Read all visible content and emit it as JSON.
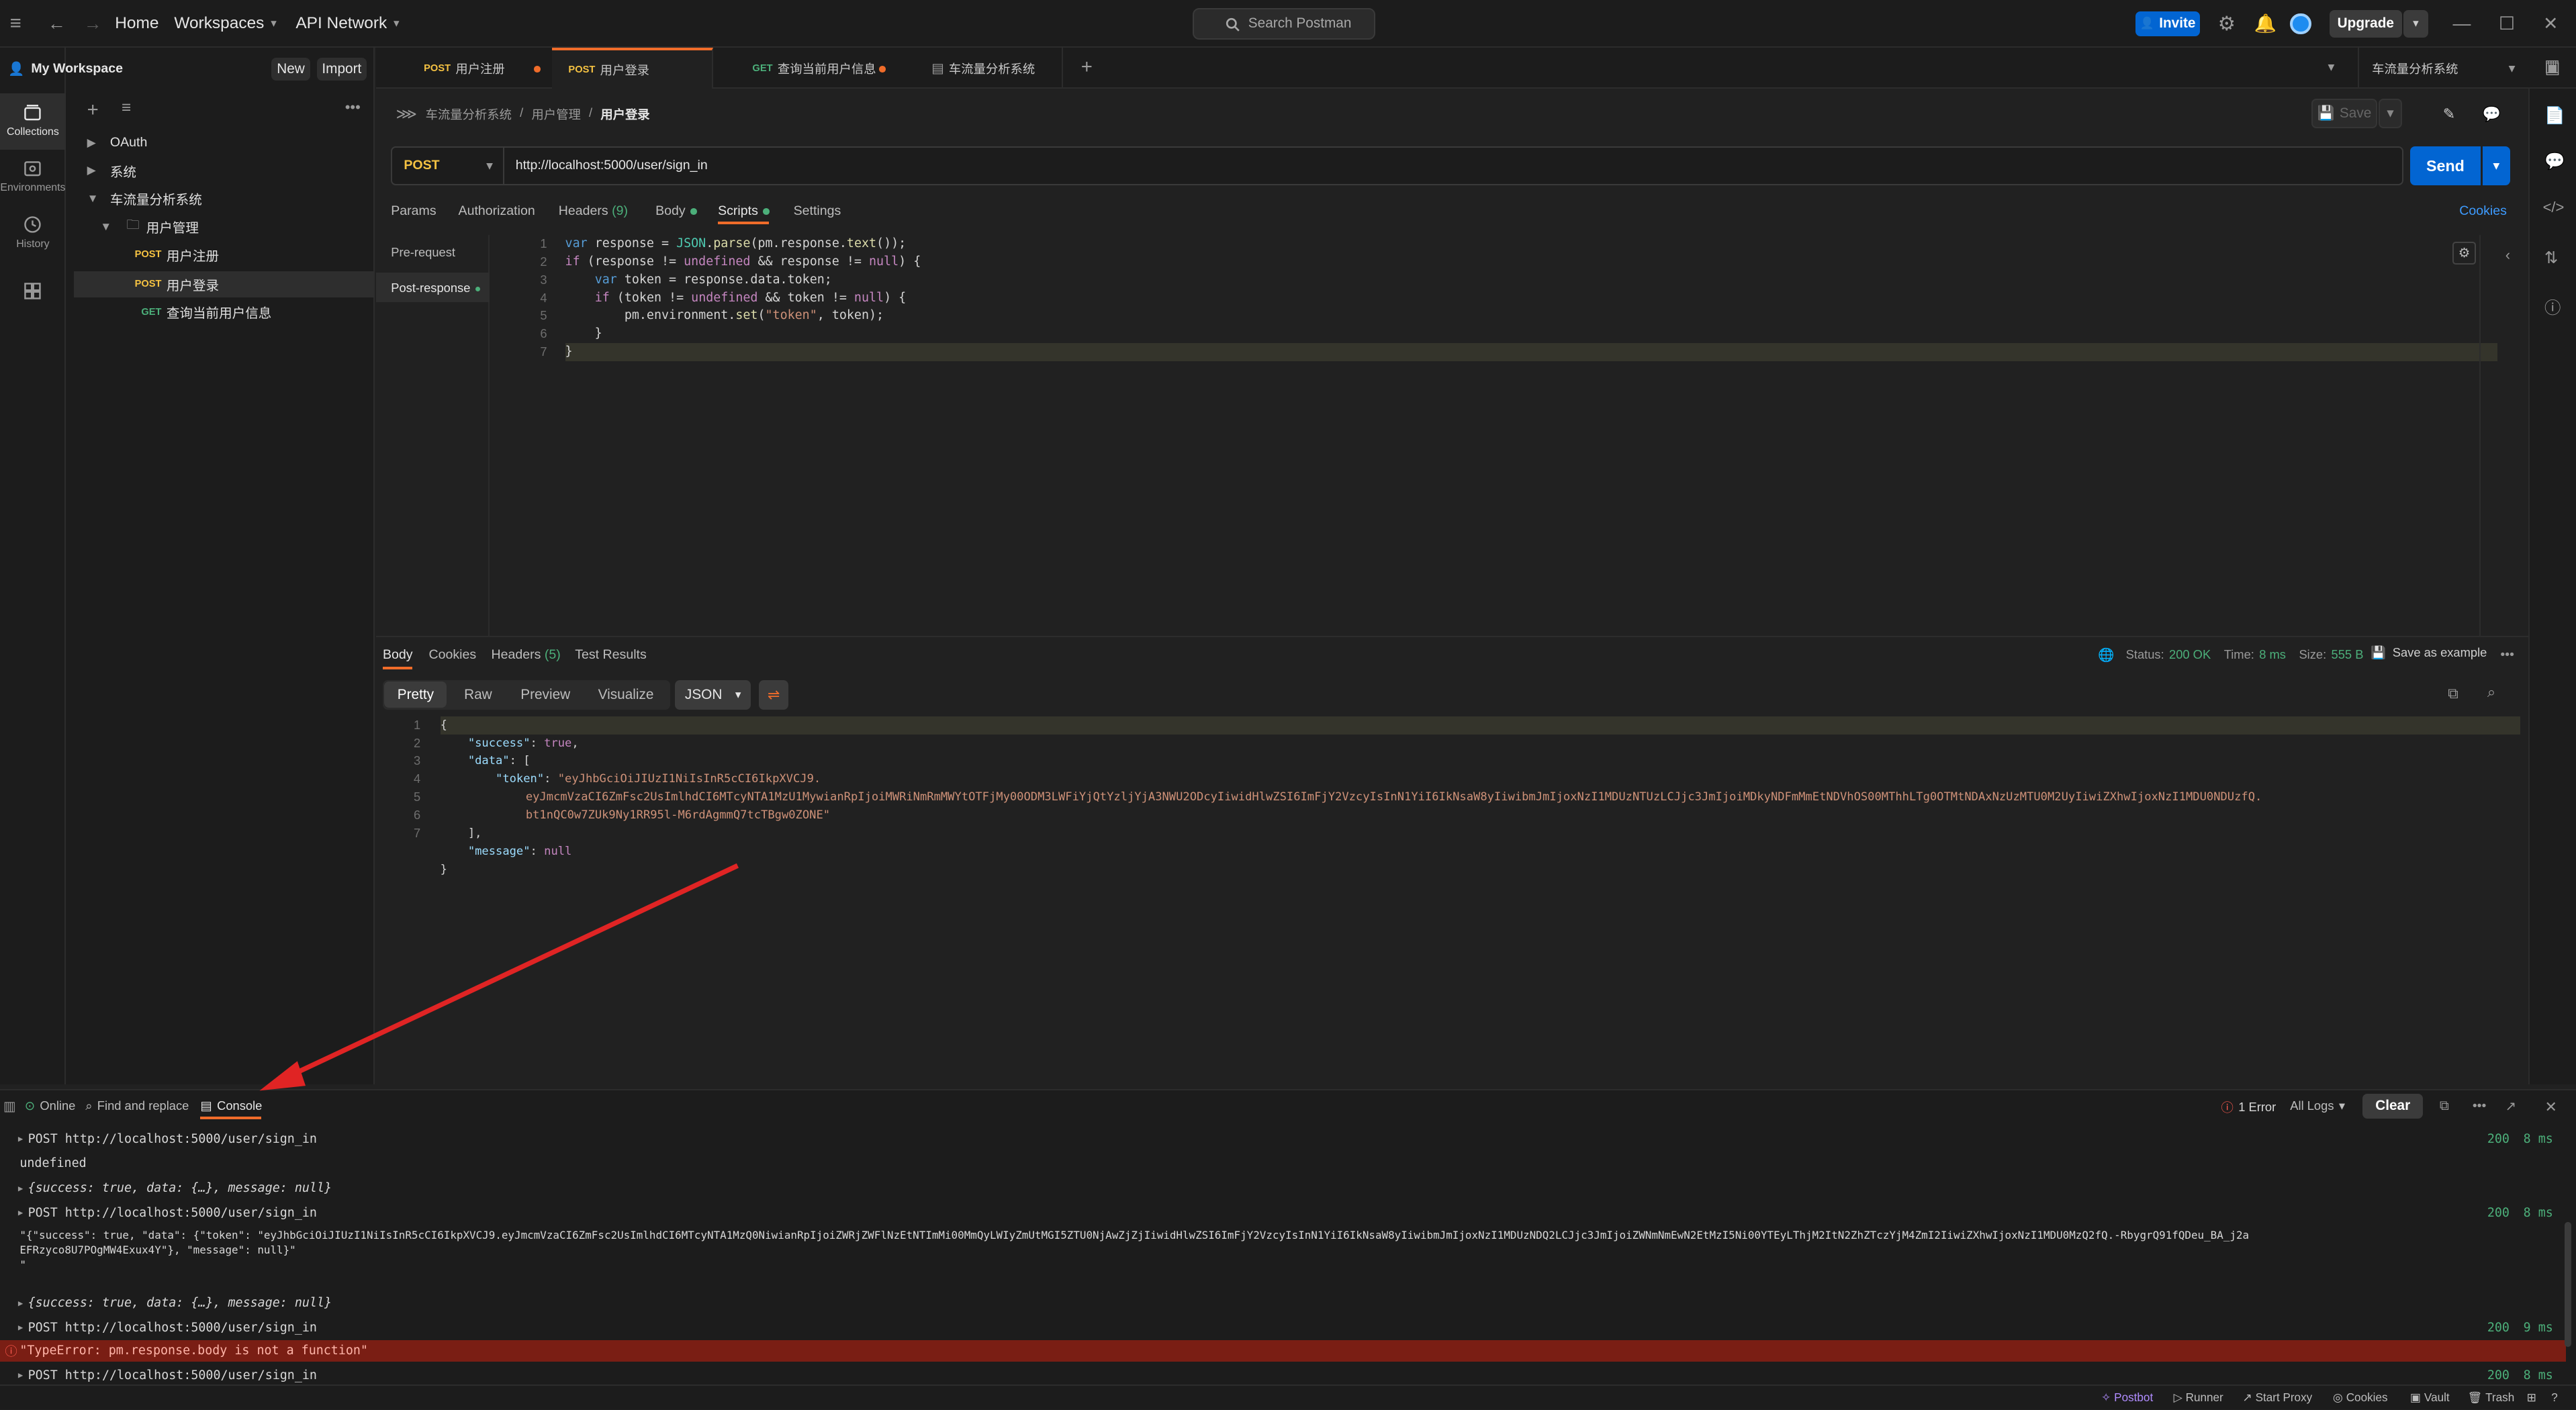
{
  "topbar": {
    "home": "Home",
    "workspaces": "Workspaces",
    "api_network": "API Network",
    "search_placeholder": "Search Postman",
    "invite": "Invite",
    "upgrade": "Upgrade"
  },
  "rail": {
    "collections": "Collections",
    "environments": "Environments",
    "history": "History"
  },
  "sidebar": {
    "workspace": "My Workspace",
    "new": "New",
    "import": "Import",
    "items": [
      {
        "label": "OAuth"
      },
      {
        "label": "系统"
      },
      {
        "label": "车流量分析系统"
      },
      {
        "label": "用户管理"
      },
      {
        "method": "POST",
        "label": "用户注册"
      },
      {
        "method": "POST",
        "label": "用户登录"
      },
      {
        "method": "GET",
        "label": "查询当前用户信息"
      }
    ]
  },
  "tabs": [
    {
      "method": "POST",
      "label": "用户注册"
    },
    {
      "method": "POST",
      "label": "用户登录"
    },
    {
      "method": "GET",
      "label": "查询当前用户信息"
    },
    {
      "label": "车流量分析系统"
    }
  ],
  "env": {
    "selected": "车流量分析系统"
  },
  "breadcrumb": {
    "root": "车流量分析系统",
    "sep1": "/",
    "folder": "用户管理",
    "sep2": "/",
    "current": "用户登录"
  },
  "save": "Save",
  "request": {
    "method": "POST",
    "url": "http://localhost:5000/user/sign_in",
    "send": "Send"
  },
  "req_tabs": {
    "params": "Params",
    "authorization": "Authorization",
    "headers": "Headers",
    "headers_count": "(9)",
    "body": "Body",
    "scripts": "Scripts",
    "settings": "Settings",
    "cookies": "Cookies"
  },
  "scripts": {
    "pre": "Pre-request",
    "post": "Post-response",
    "line_numbers": [
      "1",
      "2",
      "3",
      "4",
      "5",
      "6",
      "7"
    ]
  },
  "resp_tabs": {
    "body": "Body",
    "cookies": "Cookies",
    "headers": "Headers",
    "headers_count": "(5)",
    "tests": "Test Results",
    "status_label": "Status:",
    "status": "200 OK",
    "time_label": "Time:",
    "time": "8 ms",
    "size_label": "Size:",
    "size": "555 B",
    "save_example": "Save as example"
  },
  "view": {
    "pretty": "Pretty",
    "raw": "Raw",
    "preview": "Preview",
    "visualize": "Visualize",
    "format": "JSON"
  },
  "response_json": {
    "line_numbers": [
      "1",
      "2",
      "3",
      "4",
      "",
      "",
      "5",
      "6",
      "7"
    ],
    "token_1": "\"eyJhbGciOiJIUzI1NiIsInR5cCI6IkpXVCJ9.",
    "token_2": "eyJmcmVzaCI6ZmFsc2UsImlhdCI6MTcyNTA1MzU1MywianRpIjoiMWRiNmRmMWYtOTFjMy00ODM3LWFiYjQtYzljYjA3NWU2ODcyIiwidHlwZSI6ImFjY2VzcyIsInN1YiI6IkNsaW8yIiwibmJmIjoxNzI1MDUzNTUzLCJjc3JmIjoiMDkyNDFmMmEtNDVhOS00MThhLTg0OTMtNDAxNzUzMTU0M2UyIiwiZXhwIjoxNzI1MDU0NDUzfQ.",
    "token_3": "bt1nQC0w7ZUk9Ny1RR95l-M6rdAgmmQ7tcTBgw0ZONE\""
  },
  "bottom": {
    "online": "Online",
    "find_replace": "Find and replace",
    "console": "Console",
    "errors": "1 Error",
    "all_logs": "All Logs",
    "clear": "Clear"
  },
  "console_rows": [
    {
      "text": "POST http://localhost:5000/user/sign_in",
      "status": "200",
      "time": "8 ms"
    },
    {
      "text": "undefined"
    },
    {
      "text": "{success: true, data: {…}, message: null}"
    },
    {
      "text": "POST http://localhost:5000/user/sign_in",
      "status": "200",
      "time": "8 ms"
    },
    {
      "text": "\"{\"success\": true, \"data\": {\"token\": \"eyJhbGciOiJIUzI1NiIsInR5cCI6IkpXVCJ9.eyJmcmVzaCI6ZmFsc2UsImlhdCI6MTcyNTA1MzQ0NiwianRpIjoiZWRjZWFlNzEtNTImMi00MmQyLWIyZmUtMGI5ZTU0NjAwZjZjIiwidHlwZSI6ImFjY2VzcyIsInN1YiI6IkNsaW8yIiwibmJmIjoxNzI1MDUzNDQ2LCJjc3JmIjoiZWNmNmEwN2EtMzI5Ni00YTEyLThjM2ItN2ZhZTczYjM4ZmI2IiwiZXhwIjoxNzI1MDU0MzQ2fQ.-RbygrQ91fQDeu_BA_j2a",
      "text2": "EFRzyco8U7POgMW4Exux4Y\"}, \"message\": null}\"",
      "text3": "\""
    },
    {
      "text": "{success: true, data: {…}, message: null}"
    },
    {
      "text": "POST http://localhost:5000/user/sign_in",
      "status": "200",
      "time": "9 ms"
    },
    {
      "text": "\"TypeError: pm.response.body is not a function\""
    },
    {
      "text": "POST http://localhost:5000/user/sign_in",
      "status": "200",
      "time": "8 ms"
    }
  ],
  "statusbar": {
    "postbot": "Postbot",
    "runner": "Runner",
    "start_proxy": "Start Proxy",
    "cookies": "Cookies",
    "vault": "Vault",
    "trash": "Trash"
  },
  "colors": {
    "accent_blue": "#0265d2",
    "post": "#f5c242",
    "get": "#4caf7a",
    "error": "#7a1e14",
    "arrow": "#e02424"
  }
}
